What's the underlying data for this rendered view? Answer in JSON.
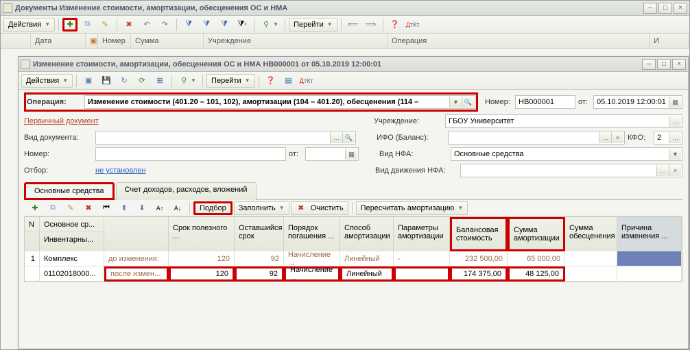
{
  "outerWindow": {
    "title": "Документы Изменение стоимости, амортизации, обесценения ОС и НМА",
    "actions": "Действия",
    "goto": "Перейти",
    "columns": {
      "date": "Дата",
      "number": "Номер",
      "sum": "Сумма",
      "org": "Учреждение",
      "operation": "Операция",
      "last": "И"
    }
  },
  "innerWindow": {
    "title": "Изменение стоимости, амортизации, обесценения ОС и НМА НВ000001 от 05.10.2019 12:00:01",
    "actions": "Действия",
    "goto": "Перейти",
    "operationLbl": "Операция:",
    "operationVal": "Изменение стоимости (401.20 – 101, 102), амортизации (104 – 401.20), обесценения (114 –",
    "numberLbl": "Номер:",
    "numberVal": "НВ000001",
    "fromLbl": "от:",
    "dateVal": "05.10.2019 12:00:01",
    "primaryDoc": "Первичный документ",
    "orgLbl": "Учреждение:",
    "orgVal": "ГБОУ Университет",
    "docTypeLbl": "Вид документа:",
    "ifoLbl": "ИФО (Баланс):",
    "kfoLbl": "КФО:",
    "kfoVal": "2",
    "numLbl": "Номер:",
    "fromLbl2": "от:",
    "nfaTypeLbl": "Вид НФА:",
    "nfaTypeVal": "Основные средства",
    "selectionLbl": "Отбор:",
    "selectionVal": "не установлен",
    "nfaMoveLbl": "Вид движения НФА:",
    "tab1": "Основные средства",
    "tab2": "Счет доходов, расходов, вложений",
    "subtool": {
      "pick": "Подбор",
      "fill": "Заполнить",
      "clear": "Очистить",
      "recalc": "Пересчитать амортизацию"
    },
    "gridHeaders": {
      "n": "N",
      "asset": "Основное ср...",
      "inv": "Инвентарны...",
      "useful": "Срок полезного ...",
      "remain": "Оставшийся срок",
      "payoff": "Порядок погашения ...",
      "method": "Способ амортизации",
      "params": "Параметры амортизации",
      "balance": "Балансовая стоимость",
      "amort": "Сумма амортизации",
      "impair": "Сумма обесценения",
      "reason": "Причина изменения ..."
    },
    "rows": {
      "r1": {
        "n": "1",
        "asset": "Комплекс",
        "inv": "01102018000...",
        "before": "до изменения:",
        "after": "после измен...",
        "useful1": "120",
        "useful2": "120",
        "remain1": "92",
        "remain2": "92",
        "payoff1": "Начисление ...",
        "payoff2": "Начисление ...",
        "method1": "Линейный",
        "method2": "Линейный",
        "params1": "-",
        "bal1": "232 500,00",
        "bal2": "174 375,00",
        "amort1": "65 000,00",
        "amort2": "48 125,00"
      }
    }
  }
}
